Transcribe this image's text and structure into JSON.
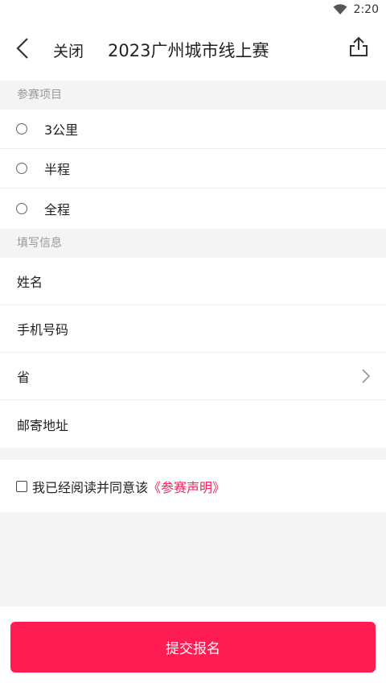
{
  "status_bar": {
    "time": "2:20"
  },
  "header": {
    "close_label": "关闭",
    "title": "2023广州城市线上赛"
  },
  "section_event": {
    "title": "参赛项目",
    "options": [
      {
        "label": "3公里"
      },
      {
        "label": "半程"
      },
      {
        "label": "全程"
      }
    ]
  },
  "section_info": {
    "title": "填写信息",
    "fields": [
      {
        "label": "姓名"
      },
      {
        "label": "手机号码"
      },
      {
        "label": "省"
      },
      {
        "label": "邮寄地址"
      }
    ]
  },
  "agreement": {
    "text": "我已经阅读并同意该",
    "link": "《参赛声明》"
  },
  "footer": {
    "submit_label": "提交报名"
  },
  "colors": {
    "accent": "#ff1c53",
    "link": "#f0265a"
  },
  "icons": [
    "wifi-icon",
    "back-arrow-icon",
    "share-icon",
    "chevron-right-icon"
  ]
}
